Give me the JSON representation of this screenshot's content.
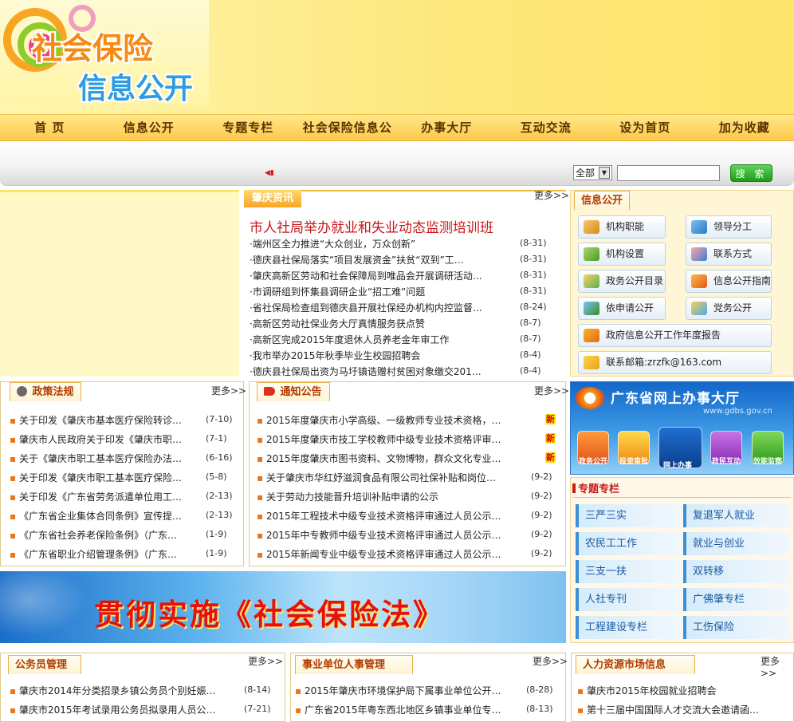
{
  "logo": {
    "line1": "社会保险",
    "line2": "信息公开"
  },
  "nav": [
    "首  页",
    "信息公开",
    "专题专栏",
    "社会保险信息公开",
    "办事大厅",
    "互动交流",
    "设为首页",
    "加为收藏"
  ],
  "search": {
    "scope": "全部",
    "button": "搜 索"
  },
  "news": {
    "tab": "肇庆资讯",
    "more": "更多>>",
    "headline": "市人社局举办就业和失业动态监测培训班",
    "items": [
      {
        "t": "·端州区全力推进“大众创业，万众创新”",
        "d": "(8-31)"
      },
      {
        "t": "·德庆县社保局落实“项目发展资金”扶贫“双到”工…",
        "d": "(8-31)"
      },
      {
        "t": "·肇庆高新区劳动和社会保障局到唯品会开展调研活动…",
        "d": "(8-31)"
      },
      {
        "t": "·市调研组到怀集县调研企业“招工难”问题",
        "d": "(8-31)"
      },
      {
        "t": "·省社保局检查组到德庆县开展社保经办机构内控监督…",
        "d": "(8-24)"
      },
      {
        "t": "·高新区劳动社保业务大厅真情服务获点赞",
        "d": "(8-7)"
      },
      {
        "t": "·高新区完成2015年度退休人员养老金年审工作",
        "d": "(8-7)"
      },
      {
        "t": "·我市举办2015年秋季毕业生校园招聘会",
        "d": "(8-4)"
      },
      {
        "t": "·德庆县社保局出资为马圩镇诰赠村贫困对象缴交201…",
        "d": "(8-4)"
      }
    ]
  },
  "policy": {
    "tab": "政策法规",
    "more": "更多>>",
    "items": [
      {
        "t": "关于印发《肇庆市基本医疗保险转诊…",
        "d": "(7-10)"
      },
      {
        "t": "肇庆市人民政府关于印发《肇庆市职…",
        "d": "(7-1)"
      },
      {
        "t": "关于《肇庆市职工基本医疗保险办法…",
        "d": "(6-16)"
      },
      {
        "t": "关于印发《肇庆市职工基本医疗保险…",
        "d": "(5-8)"
      },
      {
        "t": "关于印发《广东省劳务派遣单位用工…",
        "d": "(2-13)"
      },
      {
        "t": "《广东省企业集体合同条例》宣传提…",
        "d": "(2-13)"
      },
      {
        "t": "《广东省社会养老保险条例》（广东…",
        "d": "(1-9)"
      },
      {
        "t": "《广东省职业介绍管理条例》（广东…",
        "d": "(1-9)"
      }
    ]
  },
  "notice": {
    "tab": "通知公告",
    "more": "更多>>",
    "new_label": "新",
    "items": [
      {
        "t": "2015年度肇庆市小学高级、一级教师专业技术资格，…",
        "d": ""
      },
      {
        "t": "2015年度肇庆市技工学校教师中级专业技术资格评审…",
        "d": ""
      },
      {
        "t": "2015年度肇庆市图书资料、文物博物，群众文化专业…",
        "d": ""
      },
      {
        "t": "关于肇庆市华红妤滋润食品有限公司社保补贴和岗位…",
        "d": "(9-2)"
      },
      {
        "t": "关于劳动力技能晋升培训补贴申请的公示",
        "d": "(9-2)"
      },
      {
        "t": "2015年工程技术中级专业技术资格评审通过人员公示…",
        "d": "(9-2)"
      },
      {
        "t": "2015年中专教师中级专业技术资格评审通过人员公示…",
        "d": "(9-2)"
      },
      {
        "t": "2015年新闻专业中级专业技术资格评审通过人员公示…",
        "d": "(9-2)"
      }
    ]
  },
  "info": {
    "tab": "信息公开",
    "buttons": [
      "机构职能",
      "领导分工",
      "机构设置",
      "联系方式",
      "政务公开目录",
      "信息公开指南",
      "依申请公开",
      "党务公开"
    ],
    "report": "政府信息公开工作年度报告",
    "email": "联系邮箱:zrzfk@163.com"
  },
  "gdbs": {
    "title": "广东省网上办事大厅",
    "url": "www.gdbs.gov.cn",
    "icons": [
      "政务公开",
      "投资审批",
      "网上办事",
      "政民互动",
      "效能监察"
    ]
  },
  "topics": {
    "tab": "专题专栏",
    "items": [
      "三严三实",
      "复退军人就业",
      "农民工工作",
      "就业与创业",
      "三支一扶",
      "双转移",
      "人社专刊",
      "广佛肇专栏",
      "工程建设专栏",
      "工伤保险"
    ]
  },
  "banner": {
    "text": "贯彻实施《社会保险法》"
  },
  "civil": {
    "tab": "公务员管理",
    "more": "更多>>",
    "items": [
      {
        "t": "肇庆市2014年分类招录乡镇公务员个别妊娠…",
        "d": "(8-14)"
      },
      {
        "t": "肇庆市2015年考试录用公务员拟录用人员公…",
        "d": "(7-21)"
      }
    ]
  },
  "pi": {
    "tab": "事业单位人事管理",
    "more": "更多>>",
    "items": [
      {
        "t": "2015年肇庆市环境保护局下属事业单位公开…",
        "d": "(8-28)"
      },
      {
        "t": "广东省2015年粤东西北地区乡镇事业单位专…",
        "d": "(8-13)"
      }
    ]
  },
  "hr": {
    "tab": "人力资源市场信息",
    "more": "更多>>",
    "items": [
      {
        "t": "肇庆市2015年校园就业招聘会",
        "d": ""
      },
      {
        "t": "第十三届中国国际人才交流大会邀请函…",
        "d": ""
      }
    ]
  }
}
